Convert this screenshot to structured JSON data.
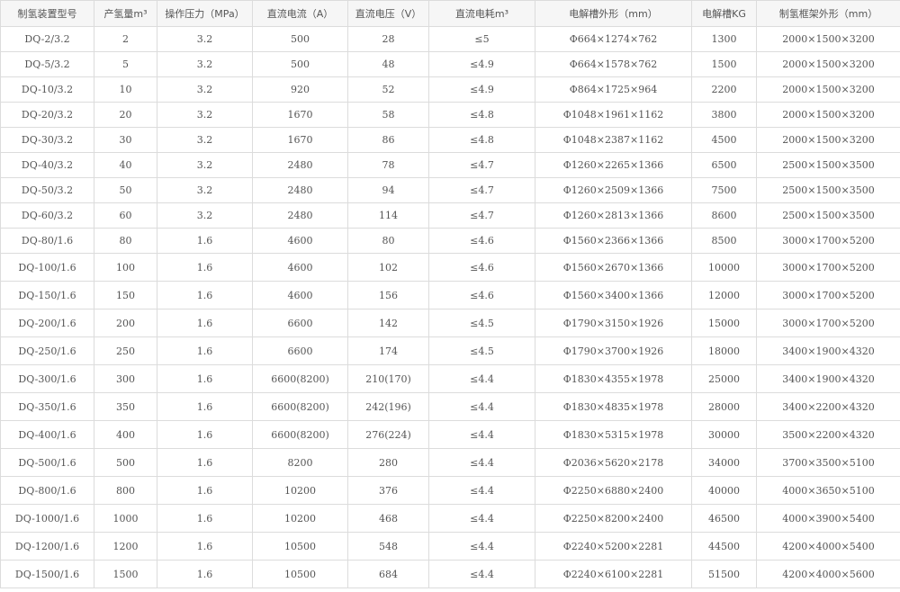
{
  "table": {
    "headers": [
      "制氢装置型号",
      "产氢量m³",
      "操作压力（MPa）",
      "直流电流（A）",
      "直流电压（V）",
      "直流电耗m³",
      "电解槽外形（mm）",
      "电解槽KG",
      "制氢框架外形（mm）"
    ],
    "rows": [
      [
        "DQ-2/3.2",
        "2",
        "3.2",
        "500",
        "28",
        "≤5",
        "Φ664×1274×762",
        "1300",
        "2000×1500×3200"
      ],
      [
        "DQ-5/3.2",
        "5",
        "3.2",
        "500",
        "48",
        "≤4.9",
        "Φ664×1578×762",
        "1500",
        "2000×1500×3200"
      ],
      [
        "DQ-10/3.2",
        "10",
        "3.2",
        "920",
        "52",
        "≤4.9",
        "Φ864×1725×964",
        "2200",
        "2000×1500×3200"
      ],
      [
        "DQ-20/3.2",
        "20",
        "3.2",
        "1670",
        "58",
        "≤4.8",
        "Φ1048×1961×1162",
        "3800",
        "2000×1500×3200"
      ],
      [
        "DQ-30/3.2",
        "30",
        "3.2",
        "1670",
        "86",
        "≤4.8",
        "Φ1048×2387×1162",
        "4500",
        "2000×1500×3200"
      ],
      [
        "DQ-40/3.2",
        "40",
        "3.2",
        "2480",
        "78",
        "≤4.7",
        "Φ1260×2265×1366",
        "6500",
        "2500×1500×3500"
      ],
      [
        "DQ-50/3.2",
        "50",
        "3.2",
        "2480",
        "94",
        "≤4.7",
        "Φ1260×2509×1366",
        "7500",
        "2500×1500×3500"
      ],
      [
        "DQ-60/3.2",
        "60",
        "3.2",
        "2480",
        "114",
        "≤4.7",
        "Φ1260×2813×1366",
        "8600",
        "2500×1500×3500"
      ],
      [
        "DQ-80/1.6",
        "80",
        "1.6",
        "4600",
        "80",
        "≤4.6",
        "Φ1560×2366×1366",
        "8500",
        "3000×1700×5200"
      ],
      [
        "DQ-100/1.6",
        "100",
        "1.6",
        "4600",
        "102",
        "≤4.6",
        "Φ1560×2670×1366",
        "10000",
        "3000×1700×5200"
      ],
      [
        "DQ-150/1.6",
        "150",
        "1.6",
        "4600",
        "156",
        "≤4.6",
        "Φ1560×3400×1366",
        "12000",
        "3000×1700×5200"
      ],
      [
        "DQ-200/1.6",
        "200",
        "1.6",
        "6600",
        "142",
        "≤4.5",
        "Φ1790×3150×1926",
        "15000",
        "3000×1700×5200"
      ],
      [
        "DQ-250/1.6",
        "250",
        "1.6",
        "6600",
        "174",
        "≤4.5",
        "Φ1790×3700×1926",
        "18000",
        "3400×1900×4320"
      ],
      [
        "DQ-300/1.6",
        "300",
        "1.6",
        "6600(8200)",
        "210(170)",
        "≤4.4",
        "Φ1830×4355×1978",
        "25000",
        "3400×1900×4320"
      ],
      [
        "DQ-350/1.6",
        "350",
        "1.6",
        "6600(8200)",
        "242(196)",
        "≤4.4",
        "Φ1830×4835×1978",
        "28000",
        "3400×2200×4320"
      ],
      [
        "DQ-400/1.6",
        "400",
        "1.6",
        "6600(8200)",
        "276(224)",
        "≤4.4",
        "Φ1830×5315×1978",
        "30000",
        "3500×2200×4320"
      ],
      [
        "DQ-500/1.6",
        "500",
        "1.6",
        "8200",
        "280",
        "≤4.4",
        "Φ2036×5620×2178",
        "34000",
        "3700×3500×5100"
      ],
      [
        "DQ-800/1.6",
        "800",
        "1.6",
        "10200",
        "376",
        "≤4.4",
        "Φ2250×6880×2400",
        "40000",
        "4000×3650×5100"
      ],
      [
        "DQ-1000/1.6",
        "1000",
        "1.6",
        "10200",
        "468",
        "≤4.4",
        "Φ2250×8200×2400",
        "46500",
        "4000×3900×5400"
      ],
      [
        "DQ-1200/1.6",
        "1200",
        "1.6",
        "10500",
        "548",
        "≤4.4",
        "Φ2240×5200×2281",
        "44500",
        "4200×4000×5400"
      ],
      [
        "DQ-1500/1.6",
        "1500",
        "1.6",
        "10500",
        "684",
        "≤4.4",
        "Φ2240×6100×2281",
        "51500",
        "4200×4000×5600"
      ]
    ]
  }
}
